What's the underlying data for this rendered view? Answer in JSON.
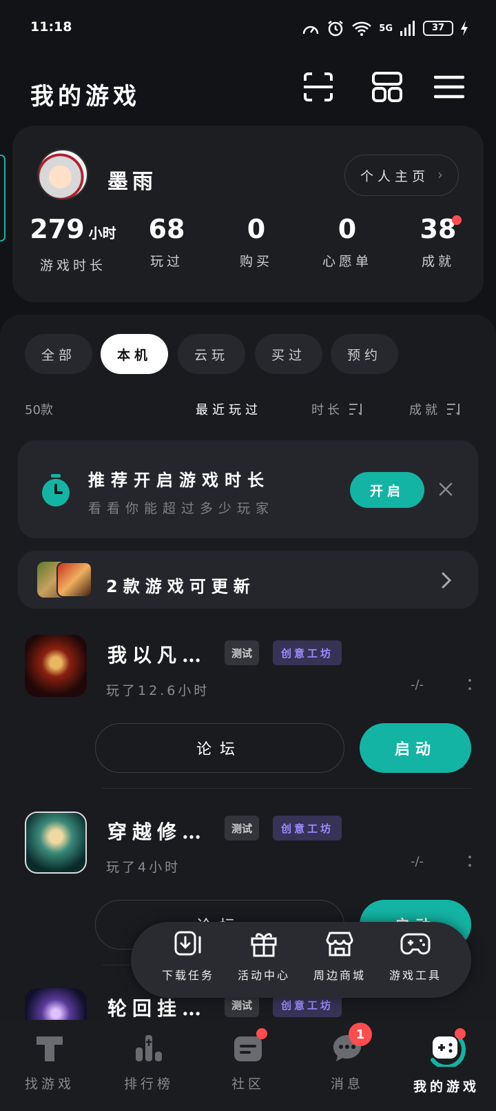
{
  "status": {
    "time": "11:18",
    "network": "5G",
    "battery": "37"
  },
  "header": {
    "title": "我的游戏"
  },
  "profile": {
    "name": "墨雨",
    "home_button": "个人主页",
    "stats": [
      {
        "value": "279",
        "unit": "小时",
        "label": "游戏时长"
      },
      {
        "value": "68",
        "label": "玩过"
      },
      {
        "value": "0",
        "label": "购买"
      },
      {
        "value": "0",
        "label": "心愿单"
      },
      {
        "value": "38",
        "label": "成就"
      }
    ]
  },
  "tabs": [
    "全部",
    "本机",
    "云玩",
    "买过",
    "预约"
  ],
  "active_tab": "本机",
  "sort": {
    "count": "50款",
    "recent": "最近玩过",
    "duration": "时长",
    "achievement": "成就"
  },
  "recommend": {
    "title": "推荐开启游戏时长",
    "subtitle": "看看你能超过多少玩家",
    "button": "开启"
  },
  "update": {
    "text": "2款游戏可更新"
  },
  "games": [
    {
      "title": "我以凡…",
      "tag1": "测试",
      "tag2": "创意工坊",
      "played": "玩了12.6小时",
      "value": "-/-",
      "forum": "论坛",
      "launch": "启动"
    },
    {
      "title": "穿越修…",
      "tag1": "测试",
      "tag2": "创意工坊",
      "played": "玩了4小时",
      "value": "-/-",
      "forum": "论坛",
      "launch": "启动"
    },
    {
      "title": "轮回挂…",
      "tag1": "测试",
      "tag2": "创意工坊"
    }
  ],
  "popup": [
    {
      "label": "下载任务",
      "icon": "download-icon"
    },
    {
      "label": "活动中心",
      "icon": "gift-icon"
    },
    {
      "label": "周边商城",
      "icon": "shop-icon"
    },
    {
      "label": "游戏工具",
      "icon": "gamepad-icon"
    }
  ],
  "nav": [
    {
      "label": "找游戏",
      "icon": "find-games-icon"
    },
    {
      "label": "排行榜",
      "icon": "ranking-icon"
    },
    {
      "label": "社区",
      "icon": "community-icon"
    },
    {
      "label": "消息",
      "icon": "message-icon",
      "badge": "1"
    },
    {
      "label": "我的游戏",
      "icon": "my-games-icon"
    }
  ],
  "colors": {
    "accent": "#14b4a4",
    "background": "#121316",
    "card": "#25262b",
    "badge": "#ff4d4f",
    "tag_purple": "#9d8cff"
  }
}
